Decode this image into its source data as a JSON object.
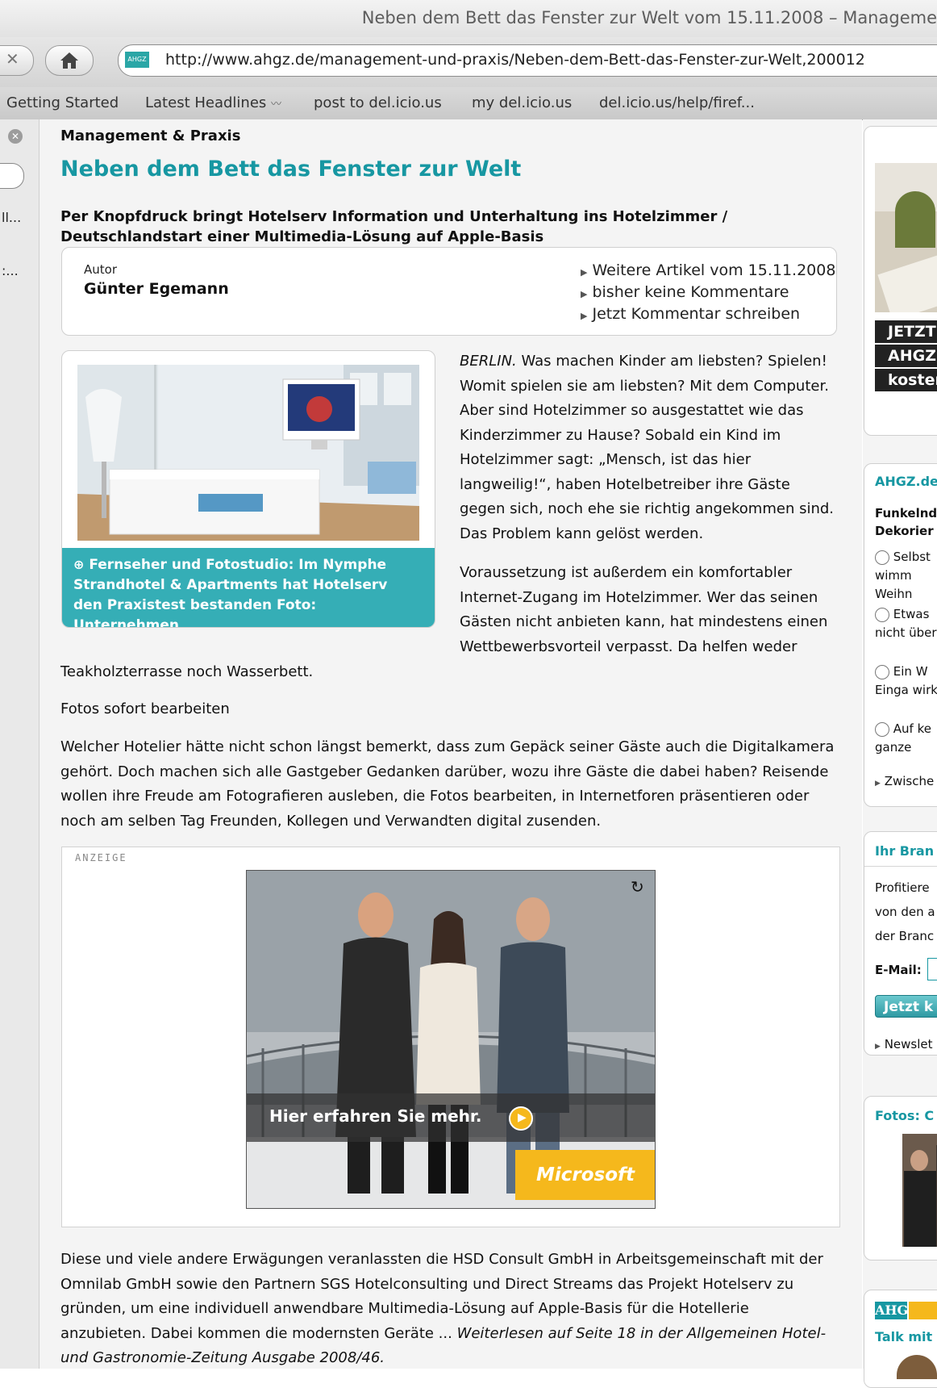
{
  "browser": {
    "window_title": "Neben dem Bett das Fenster zur Welt vom 15.11.2008 – Manageme",
    "url": "http://www.ahgz.de/management-und-praxis/Neben-dem-Bett-das-Fenster-zur-Welt,200012",
    "favicon_text": "AHGZ",
    "bookmarks": [
      "Getting Started",
      "Latest Headlines",
      "post to del.icio.us",
      "my del.icio.us",
      "del.icio.us/help/firef..."
    ],
    "sidebar_fragments": [
      "ll...",
      ":..."
    ]
  },
  "article": {
    "section": "Management & Praxis",
    "title": "Neben dem Bett das Fenster zur Welt",
    "lead": "Per Knopfdruck bringt Hotelserv Information und Unterhaltung ins Hotelzimmer / Deutschlandstart einer Multimedia-Lösung auf Apple-Basis",
    "author_label": "Autor",
    "author_name": "Günter Egemann",
    "meta_links": [
      "Weitere Artikel vom 15.11.2008",
      "bisher keine Kommentare",
      "Jetzt Kommentar schreiben"
    ],
    "image_caption": "Fernseher und Fotostudio: Im Nymphe Strandhotel & Apartments hat Hotelserv den Praxistest bestanden Foto: Unternehmen",
    "p1_city": "BERLIN.",
    "p1_text": " Was machen Kinder am liebsten? Spielen! Womit spielen sie am liebsten? Mit dem Computer. Aber sind Hotelzimmer so ausgestattet wie das Kinderzimmer zu Hause? Sobald ein Kind im Hotelzimmer sagt: „Mensch, ist das hier langweilig!“, haben Hotelbetreiber ihre Gäste gegen sich, noch ehe sie richtig angekommen sind. Das Problem kann gelöst werden.",
    "p2_text": "Voraussetzung ist außerdem ein komfortabler Internet-Zugang im Hotelzimmer. Wer das seinen Gästen nicht anbieten kann, hat mindestens einen Wettbewerbsvorteil verpasst. Da helfen weder",
    "p2_tail": "Teakholzterrasse noch Wasserbett.",
    "subhead": "Fotos sofort bearbeiten",
    "p3_text": "Welcher Hotelier hätte nicht schon längst bemerkt, dass zum Gepäck seiner Gäste auch die Digitalkamera gehört. Doch machen sich alle Gastgeber Gedanken darüber, wozu ihre Gäste die dabei haben? Reisende wollen ihre Freude am Fotografieren ausleben, die Fotos bearbeiten, in Internetforen präsentieren oder noch am selben Tag Freunden, Kollegen und Verwandten digital zusenden.",
    "p4_text": "Diese und viele andere Erwägungen veranlassten die HSD Consult GmbH in Arbeitsgemeinschaft mit der Omnilab GmbH sowie den Partnern SGS Hotelconsulting und Direct Streams das Projekt Hotelserv zu gründen, um eine individuell anwendbare Multimedia-Lösung auf Apple-Basis für die Hotellerie anzubieten. Dabei kommen die modernsten Geräte ... ",
    "p4_italic": "Weiterlesen auf Seite 18 in der Allgemeinen Hotel- und Gastronomie-Zeitung Ausgabe 2008/46."
  },
  "ad": {
    "label": "ANZEIGE",
    "cta": "Hier erfahren Sie mehr.",
    "brand": "Microsoft"
  },
  "sidebar": {
    "promo_lines": [
      "JETZT",
      "AHGZ",
      "koster"
    ],
    "poll_title": "AHGZ.de",
    "poll_question": "Funkelnd Dekorier",
    "poll_options": [
      "Selbst wimm Weihn",
      "Etwas nicht übert",
      "Ein W Einga wirkt",
      "Auf ke ganze"
    ],
    "poll_link": "Zwische",
    "newsletter_title": "Ihr Bran",
    "newsletter_text": "Profitiere von den a der Branc",
    "email_label": "E-Mail:",
    "newsletter_button": "Jetzt k",
    "newsletter_link": "Newslet",
    "photos_title": "Fotos: C",
    "logo_text": "AHGZ",
    "talk_title": "Talk mit"
  },
  "colors": {
    "accent": "#1797a2",
    "caption_bg": "#35aeb6",
    "ad_yellow": "#f5b81c"
  }
}
